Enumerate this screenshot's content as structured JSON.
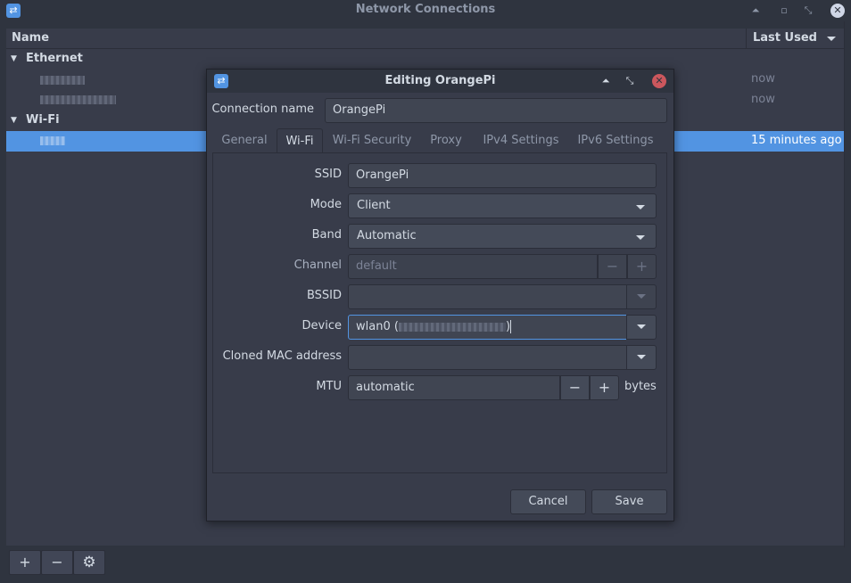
{
  "window": {
    "title": "Network Connections",
    "controls": [
      "minimize-icon",
      "restore-icon",
      "close-icon"
    ]
  },
  "list": {
    "col_name": "Name",
    "col_last_used": "Last Used",
    "groups": [
      {
        "label": "Ethernet",
        "rows": [
          {
            "last_used": "now"
          },
          {
            "last_used": "now"
          }
        ]
      },
      {
        "label": "Wi-Fi",
        "rows": [
          {
            "last_used": "15 minutes ago",
            "selected": true
          }
        ]
      }
    ]
  },
  "toolbar": {
    "add_label": "+",
    "remove_label": "−",
    "settings_icon": "gear-icon"
  },
  "dialog": {
    "title": "Editing OrangePi",
    "connection_name_label": "Connection name",
    "connection_name_value": "OrangePi",
    "tabs": [
      "General",
      "Wi-Fi",
      "Wi-Fi Security",
      "Proxy",
      "IPv4 Settings",
      "IPv6 Settings"
    ],
    "active_tab": "Wi-Fi",
    "fields": {
      "ssid_label": "SSID",
      "ssid_value": "OrangePi",
      "mode_label": "Mode",
      "mode_value": "Client",
      "band_label": "Band",
      "band_value": "Automatic",
      "channel_label": "Channel",
      "channel_placeholder": "default",
      "bssid_label": "BSSID",
      "bssid_value": "",
      "device_label": "Device",
      "device_prefix": "wlan0 (",
      "device_suffix": ")",
      "cloned_mac_label": "Cloned MAC address",
      "cloned_mac_value": "",
      "mtu_label": "MTU",
      "mtu_value": "automatic",
      "mtu_unit": "bytes",
      "minus": "−",
      "plus": "+"
    },
    "cancel_label": "Cancel",
    "save_label": "Save"
  },
  "colors": {
    "accent": "#5294e2",
    "background": "#383c4a",
    "titlebar": "#2f343f",
    "close_red": "#cc575d"
  }
}
